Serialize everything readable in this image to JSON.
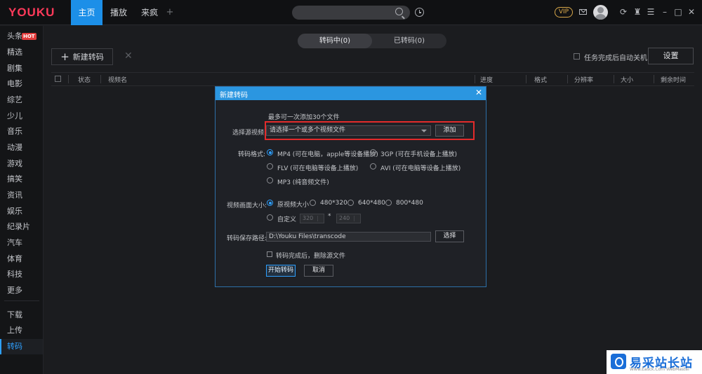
{
  "app": {
    "logo": "YOUKU"
  },
  "nav": {
    "tabs": [
      "主页",
      "播放",
      "来疯"
    ],
    "plus": "+"
  },
  "topbar": {
    "vip": "VIP"
  },
  "sidebar": {
    "hot_badge": "HOT",
    "items": [
      "头条",
      "精选",
      "剧集",
      "电影",
      "综艺",
      "少儿",
      "音乐",
      "动漫",
      "游戏",
      "搞笑",
      "资讯",
      "娱乐",
      "纪录片",
      "汽车",
      "体育",
      "科技",
      "更多"
    ],
    "bottom_items": [
      "下载",
      "上传",
      "转码"
    ],
    "active": "转码"
  },
  "main": {
    "segments": [
      "转码中(0)",
      "已转码(0)"
    ],
    "new_task": "新建转码",
    "auto_shutdown": "任务完成后自动关机",
    "settings": "设置",
    "columns": [
      "状态",
      "视频名",
      "进度",
      "格式",
      "分辨率",
      "大小",
      "剩余时间"
    ]
  },
  "modal": {
    "title": "新建转码",
    "max_note": "最多可一次添加30个文件",
    "source_label": "选择源视频:",
    "source_placeholder": "请选择一个或多个视频文件",
    "add": "添加",
    "format_label": "转码格式:",
    "formats": [
      "MP4 (可在电脑，apple等设备播放)",
      "3GP (可在手机设备上播放)",
      "FLV (可在电脑等设备上播放)",
      "AVI (可在电脑等设备上播放)",
      "MP3 (纯音频文件)"
    ],
    "size_label": "视频画面大小:",
    "sizes": [
      "原视频大小",
      "480*320",
      "640*480",
      "800*480"
    ],
    "custom": "自定义",
    "custom_w": "320",
    "custom_x": "*",
    "custom_h": "240",
    "path_label": "转码保存路径:",
    "path_value": "D:\\Youku Files\\transcode",
    "browse": "选择",
    "delete_source": "转码完成后，删除源文件",
    "start": "开始转码",
    "cancel": "取消"
  },
  "watermark": {
    "text": "易采站长站",
    "sub": "Www.Easck.Com WebMaster"
  },
  "colors": {
    "accent": "#2ea0ff",
    "highlight": "#e32b2b",
    "logo_red": "#ff3a5a"
  }
}
